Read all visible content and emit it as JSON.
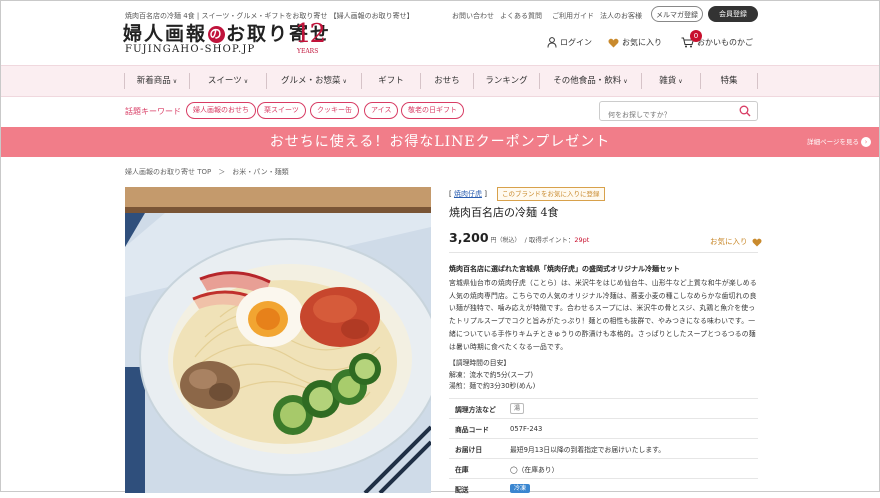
{
  "header": {
    "tagline": "焼肉百名店の冷麺 4食 | スイーツ・グルメ・ギフトをお取り寄せ 【婦人画報のお取り寄せ】",
    "logo_jp_left": "婦人画報",
    "logo_jp_no": "の",
    "logo_jp_right": "お取り寄せ",
    "logo_en": "FUJINGAHO-SHOP.JP",
    "anniv_number": "12",
    "anniv_label": "YEARS",
    "links": [
      "お問い合わせ",
      "よくある質問",
      "ご利用ガイド",
      "法人のお客様"
    ],
    "newsletter_button": "メルマガ登録",
    "member_button": "会員登録",
    "login": "ログイン",
    "favorites": "お気に入り",
    "cart": "おかいものかご",
    "cart_count": "0"
  },
  "nav": {
    "items": [
      {
        "label": "新着商品",
        "dropdown": true
      },
      {
        "label": "スイーツ",
        "dropdown": true
      },
      {
        "label": "グルメ・お惣菜",
        "dropdown": true
      },
      {
        "label": "ギフト",
        "dropdown": false
      },
      {
        "label": "おせち",
        "dropdown": false
      },
      {
        "label": "ランキング",
        "dropdown": false
      },
      {
        "label": "その他食品・飲料",
        "dropdown": true
      },
      {
        "label": "雑貨",
        "dropdown": true
      },
      {
        "label": "特集",
        "dropdown": false
      }
    ]
  },
  "keywords": {
    "label": "話題キーワード",
    "items": [
      "婦人画報のおせち",
      "栗スイーツ",
      "クッキー缶",
      "アイス",
      "敬老の日ギフト"
    ]
  },
  "search": {
    "placeholder": "何をお探しですか？"
  },
  "banner": {
    "text": "おせちに使える！お得なLINEクーポンプレゼント",
    "link": "詳細ページを見る"
  },
  "breadcrumb": "婦人画報のお取り寄せ TOP　＞　お米・パン・麺類",
  "product": {
    "brand": "焼肉仔虎",
    "brand_fav": "このブランドをお気に入りに登録",
    "title": "焼肉百名店の冷麺 4食",
    "price": "3,200",
    "price_unit": "円（税込）",
    "points_label": "/ 取得ポイント：",
    "points": "29pt",
    "fav_label": "お気に入り",
    "desc_heading": "焼肉百名店に選ばれた宮城県「焼肉仔虎」の盛岡式オリジナル冷麺セット",
    "description": "宮城県仙台市の焼肉仔虎（ことら）は、米沢牛をはじめ仙台牛、山形牛など上質な和牛が楽しめる人気の焼肉専門店。こちらでの人気のオリジナル冷麺は、蕎麦小麦の種こしなめらかな歯切れの良い麺が独特で、噛み応えが特徴です。合わせるスープには、米沢牛の骨とスジ、丸鶏と魚介を使ったトリプルスープでコクと旨みがたっぷり！麺との相性も抜群で、やみつきになる味わいです。一緒についている手作りキムチときゅうりの酢漬けも本格的。さっぱりとしたスープとつるつるの麺は暑い時期に食べたくなる一品です。",
    "cook_heading": "【調理時間の目安】",
    "cook_lines": [
      "解凍：流水で約5分(スープ)",
      "湯煎：麺で約3分30秒(めん)"
    ],
    "spec": [
      {
        "key": "調理方法など",
        "badge": "湯"
      },
      {
        "key": "商品コード",
        "value": "057F-243"
      },
      {
        "key": "お届け日",
        "value": "最短9月13日以降の到着指定でお届けいたします。"
      },
      {
        "key": "在庫",
        "value": "◯（在庫あり）"
      },
      {
        "key": "配送",
        "badge": "冷凍"
      }
    ]
  },
  "colors": {
    "accent": "#d83c64",
    "banner": "#f17d89",
    "nav_bg": "#fbeef1",
    "logo_red": "#c1133a"
  }
}
